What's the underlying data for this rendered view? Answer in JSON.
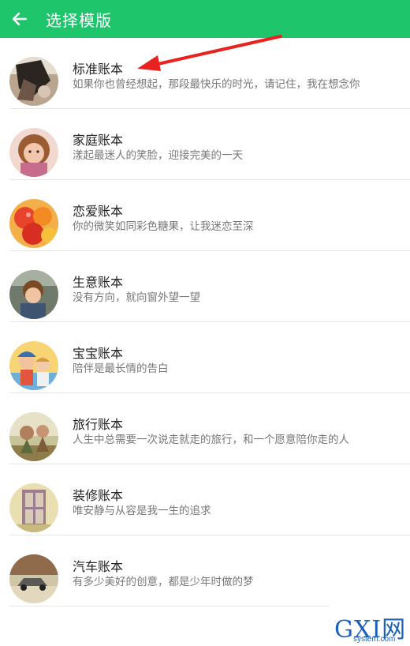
{
  "header": {
    "title": "选择模版",
    "back_icon": "arrow-left-icon",
    "color": "#1fc56a"
  },
  "templates": [
    {
      "name": "标准账本",
      "desc": "如果你也曾经想起，那段最快乐的时光，请记住，我在想念你"
    },
    {
      "name": "家庭账本",
      "desc": "漾起最迷人的笑脸，迎接完美的一天"
    },
    {
      "name": "恋爱账本",
      "desc": "你的微笑如同彩色糖果，让我迷恋至深"
    },
    {
      "name": "生意账本",
      "desc": "没有方向，就向窗外望一望"
    },
    {
      "name": "宝宝账本",
      "desc": "陪伴是最长情的告白"
    },
    {
      "name": "旅行账本",
      "desc": "人生中总需要一次说走就走的旅行，和一个愿意陪你走的人"
    },
    {
      "name": "装修账本",
      "desc": "唯安静与从容是我一生的追求"
    },
    {
      "name": "汽车账本",
      "desc": "有多少美好的创意，都是少年时做的梦"
    }
  ],
  "annotation": {
    "arrow_color": "#e8231f"
  },
  "watermark": {
    "main": "GXI网",
    "sub": "system.com"
  }
}
